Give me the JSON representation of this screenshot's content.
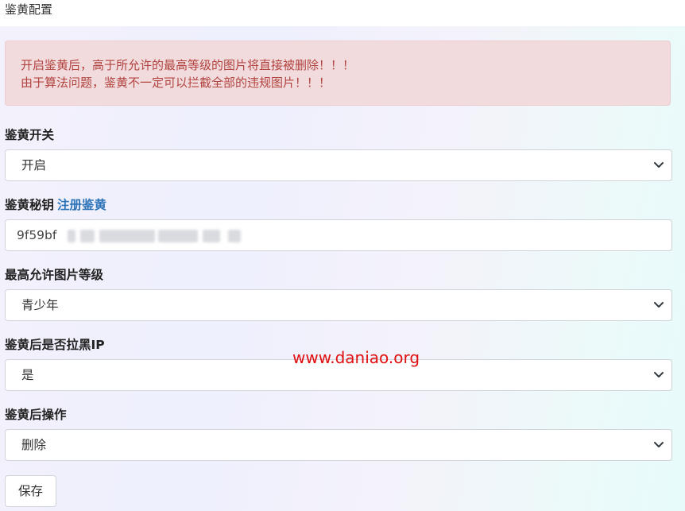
{
  "header": {
    "title": "鉴黄配置"
  },
  "alert": {
    "line1": "开启鉴黄后，高于所允许的最高等级的图片将直接被删除！！！",
    "line2": "由于算法问题，鉴黄不一定可以拦截全部的违规图片！！！"
  },
  "form": {
    "switch": {
      "label": "鉴黄开关",
      "value": "开启"
    },
    "secret": {
      "label": "鉴黄秘钥",
      "link": "注册鉴黄",
      "value": "9f59bf"
    },
    "max_level": {
      "label": "最高允许图片等级",
      "value": "青少年"
    },
    "blacklist_ip": {
      "label": "鉴黄后是否拉黑IP",
      "value": "是"
    },
    "action": {
      "label": "鉴黄后操作",
      "value": "删除"
    },
    "save_label": "保存"
  },
  "watermark": "www.daniao.org",
  "colors": {
    "alert_bg": "#f2dbdd",
    "alert_text": "#b1433f",
    "link": "#2d73b8",
    "watermark": "#e01010"
  }
}
